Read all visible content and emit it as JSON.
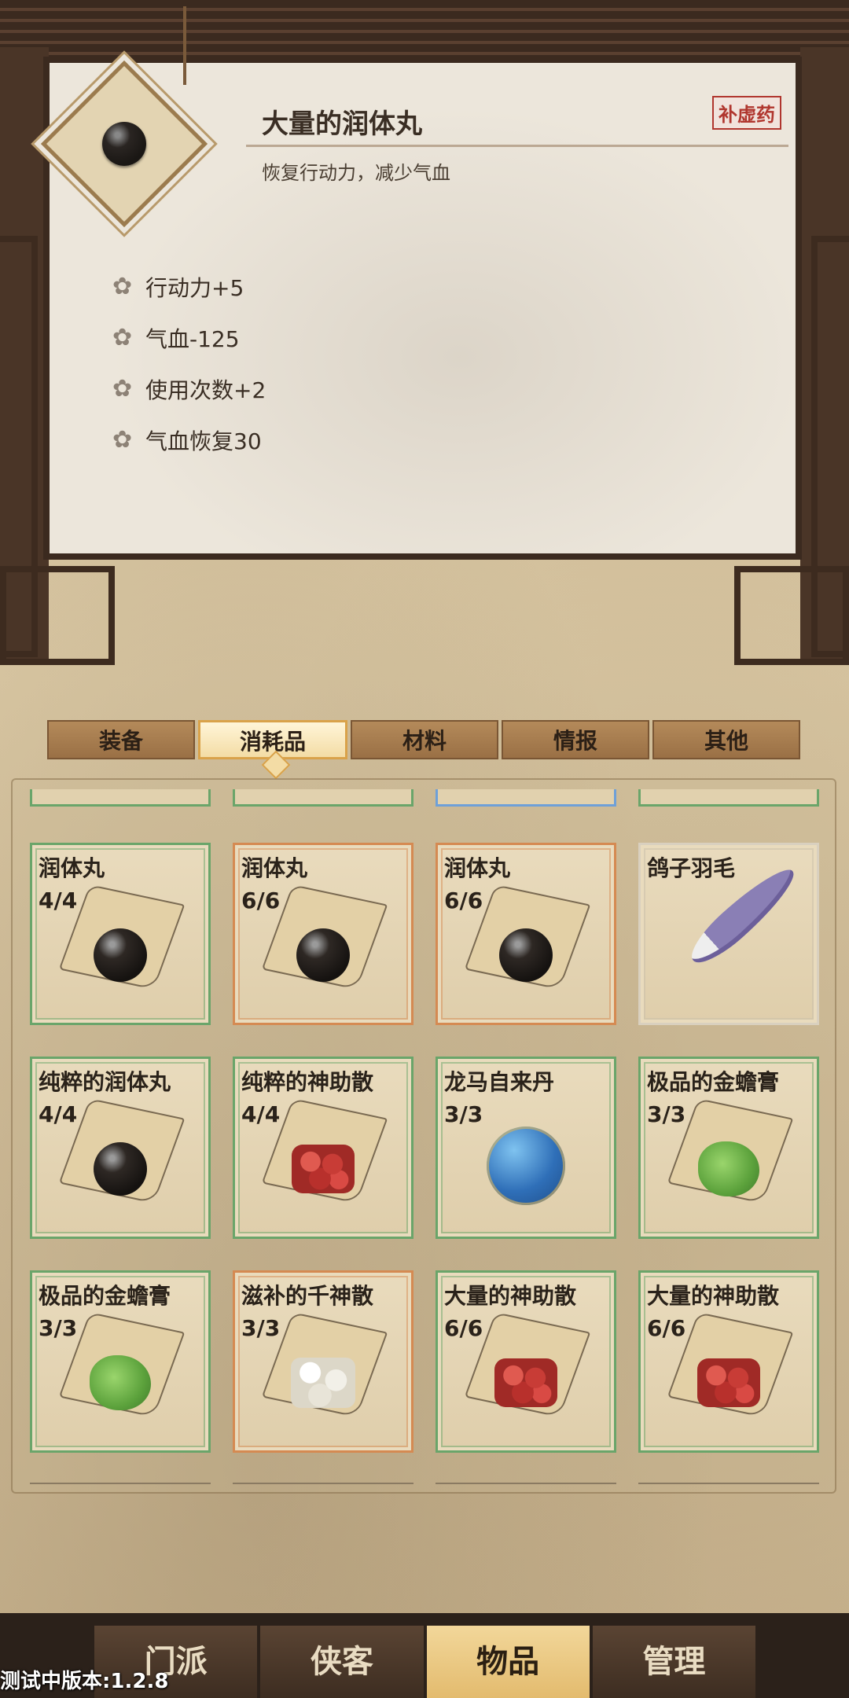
{
  "detail": {
    "title": "大量的润体丸",
    "description": "恢复行动力，减少气血",
    "tag": "补虚药",
    "stats": [
      "行动力+5",
      "气血-125",
      "使用次数+2",
      "气血恢复30"
    ]
  },
  "tabs": [
    {
      "label": "装备",
      "active": false
    },
    {
      "label": "消耗品",
      "active": true
    },
    {
      "label": "材料",
      "active": false
    },
    {
      "label": "情报",
      "active": false
    },
    {
      "label": "其他",
      "active": false
    }
  ],
  "items": [
    {
      "name": "润体丸",
      "count": "4/4",
      "icon": "black-pill-icon",
      "rarity": "green"
    },
    {
      "name": "润体丸",
      "count": "6/6",
      "icon": "black-pill-icon",
      "rarity": "orange"
    },
    {
      "name": "润体丸",
      "count": "6/6",
      "icon": "black-pill-icon",
      "rarity": "orange"
    },
    {
      "name": "鸽子羽毛",
      "count": "",
      "icon": "feather-icon",
      "rarity": "white"
    },
    {
      "name": "纯粹的润体丸",
      "count": "4/4",
      "icon": "black-pill-icon",
      "rarity": "green"
    },
    {
      "name": "纯粹的神助散",
      "count": "4/4",
      "icon": "red-powder-icon",
      "rarity": "green"
    },
    {
      "name": "龙马自来丹",
      "count": "3/3",
      "icon": "blue-orb-icon",
      "rarity": "green"
    },
    {
      "name": "极品的金蟾膏",
      "count": "3/3",
      "icon": "green-paste-icon",
      "rarity": "green"
    },
    {
      "name": "极品的金蟾膏",
      "count": "3/3",
      "icon": "green-paste-icon",
      "rarity": "green"
    },
    {
      "name": "滋补的千神散",
      "count": "3/3",
      "icon": "white-powder-icon",
      "rarity": "orange"
    },
    {
      "name": "大量的神助散",
      "count": "6/6",
      "icon": "red-powder-icon",
      "rarity": "green"
    },
    {
      "name": "大量的神助散",
      "count": "6/6",
      "icon": "red-powder-icon",
      "rarity": "green"
    }
  ],
  "nav": [
    {
      "label": "门派",
      "active": false
    },
    {
      "label": "侠客",
      "active": false
    },
    {
      "label": "物品",
      "active": true
    },
    {
      "label": "管理",
      "active": false
    }
  ],
  "version": "测试中版本:1.2.8",
  "colors": {
    "rarity_green": "#6aa56a",
    "rarity_orange": "#d58a52",
    "rarity_white": "#d9d0bf",
    "active_tab": "#f3dca5",
    "nav_active": "#e3bb6e"
  }
}
